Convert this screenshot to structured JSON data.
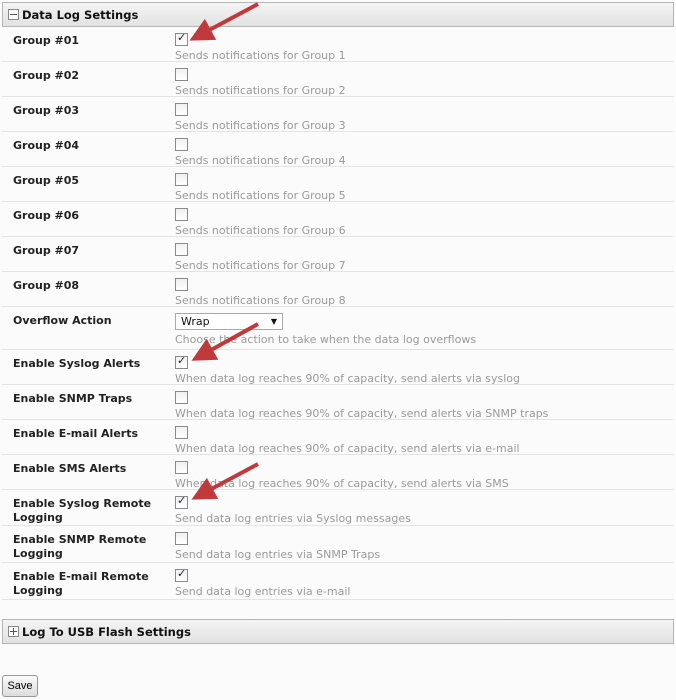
{
  "section1": {
    "title": "Data Log Settings",
    "icon": "minus-box-icon"
  },
  "rows": [
    {
      "label": "Group #01",
      "type": "checkbox",
      "checked": true,
      "desc": "Sends notifications for Group 1"
    },
    {
      "label": "Group #02",
      "type": "checkbox",
      "checked": false,
      "desc": "Sends notifications for Group 2"
    },
    {
      "label": "Group #03",
      "type": "checkbox",
      "checked": false,
      "desc": "Sends notifications for Group 3"
    },
    {
      "label": "Group #04",
      "type": "checkbox",
      "checked": false,
      "desc": "Sends notifications for Group 4"
    },
    {
      "label": "Group #05",
      "type": "checkbox",
      "checked": false,
      "desc": "Sends notifications for Group 5"
    },
    {
      "label": "Group #06",
      "type": "checkbox",
      "checked": false,
      "desc": "Sends notifications for Group 6"
    },
    {
      "label": "Group #07",
      "type": "checkbox",
      "checked": false,
      "desc": "Sends notifications for Group 7"
    },
    {
      "label": "Group #08",
      "type": "checkbox",
      "checked": false,
      "desc": "Sends notifications for Group 8"
    },
    {
      "label": "Overflow Action",
      "type": "select",
      "value": "Wrap",
      "desc": "Choose the action to take when the data log overflows"
    },
    {
      "label": "Enable Syslog Alerts",
      "type": "checkbox",
      "checked": true,
      "desc": "When data log reaches 90% of capacity, send alerts via syslog"
    },
    {
      "label": "Enable SNMP Traps",
      "type": "checkbox",
      "checked": false,
      "desc": "When data log reaches 90% of capacity, send alerts via SNMP traps"
    },
    {
      "label": "Enable E-mail Alerts",
      "type": "checkbox",
      "checked": false,
      "desc": "When data log reaches 90% of capacity, send alerts via e-mail"
    },
    {
      "label": "Enable SMS Alerts",
      "type": "checkbox",
      "checked": false,
      "desc": "When data log reaches 90% of capacity, send alerts via SMS"
    },
    {
      "label": "Enable Syslog Remote Logging",
      "type": "checkbox",
      "checked": true,
      "desc": "Send data log entries via Syslog messages"
    },
    {
      "label": "Enable SNMP Remote Logging",
      "type": "checkbox",
      "checked": false,
      "desc": "Send data log entries via SNMP Traps"
    },
    {
      "label": "Enable E-mail Remote Logging",
      "type": "checkbox",
      "checked": true,
      "desc": "Send data log entries via e-mail"
    }
  ],
  "section2": {
    "title": "Log To USB Flash Settings",
    "icon": "plus-box-icon"
  },
  "save_label": "Save",
  "annotation_color": "#c0393b"
}
